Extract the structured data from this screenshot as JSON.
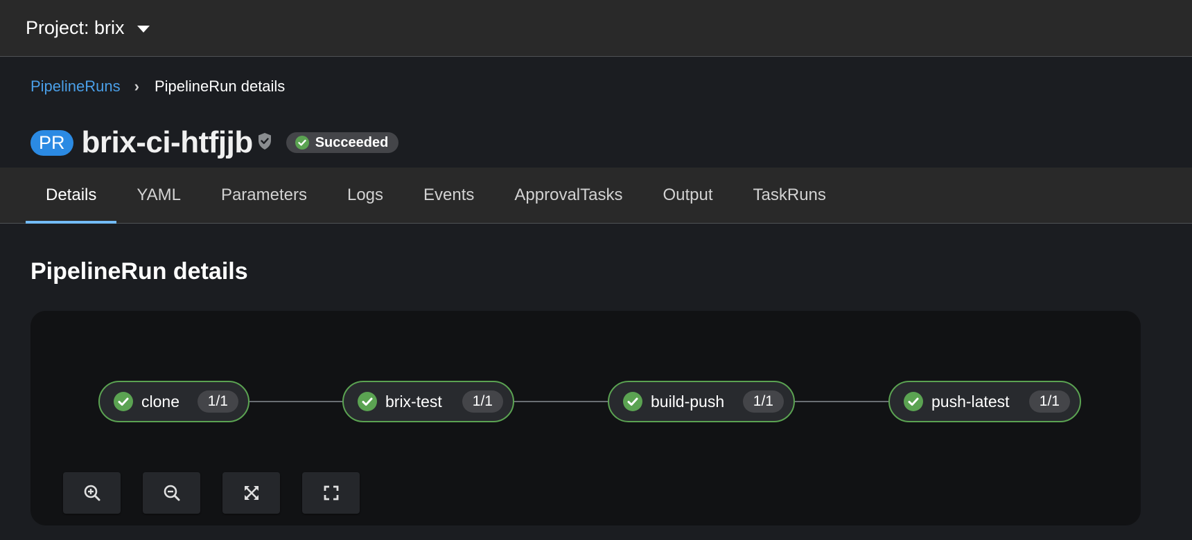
{
  "topbar": {
    "project_label": "Project: brix"
  },
  "breadcrumb": {
    "parent": "PipelineRuns",
    "current": "PipelineRun details"
  },
  "header": {
    "badge": "PR",
    "title": "brix-ci-htfjjb",
    "status": "Succeeded"
  },
  "tabs": [
    {
      "label": "Details",
      "active": true
    },
    {
      "label": "YAML"
    },
    {
      "label": "Parameters"
    },
    {
      "label": "Logs"
    },
    {
      "label": "Events"
    },
    {
      "label": "ApprovalTasks"
    },
    {
      "label": "Output"
    },
    {
      "label": "TaskRuns"
    }
  ],
  "section": {
    "title": "PipelineRun details"
  },
  "pipeline": {
    "nodes": [
      {
        "label": "clone",
        "count": "1/1",
        "status": "succeeded"
      },
      {
        "label": "brix-test",
        "count": "1/1",
        "status": "succeeded"
      },
      {
        "label": "build-push",
        "count": "1/1",
        "status": "succeeded"
      },
      {
        "label": "push-latest",
        "count": "1/1",
        "status": "succeeded"
      }
    ]
  },
  "controls": [
    {
      "name": "zoom-in",
      "icon": "zoom-in-icon"
    },
    {
      "name": "zoom-out",
      "icon": "zoom-out-icon"
    },
    {
      "name": "fit-to-screen",
      "icon": "expand-arrows-icon"
    },
    {
      "name": "reset-view",
      "icon": "fullscreen-corners-icon"
    }
  ],
  "colors": {
    "accent": "#73bcf7",
    "link": "#4a9fe8",
    "success": "#5ba352",
    "badge": "#2b8ae3"
  }
}
